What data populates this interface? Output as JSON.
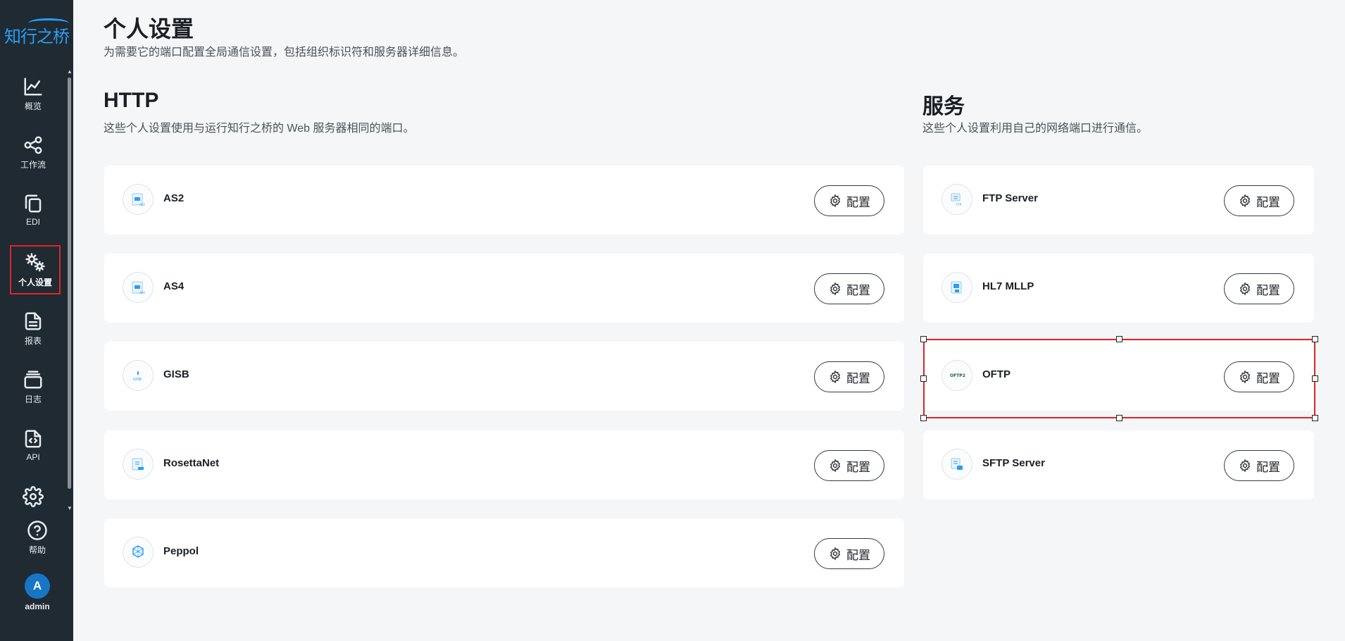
{
  "app": {
    "logo_text": "知行之桥"
  },
  "nav": {
    "items": [
      {
        "id": "overview",
        "label": "概览",
        "icon": "chart-line-icon"
      },
      {
        "id": "workflow",
        "label": "工作流",
        "icon": "share-nodes-icon"
      },
      {
        "id": "edi",
        "label": "EDI",
        "icon": "copy-docs-icon"
      },
      {
        "id": "profile",
        "label": "个人设置",
        "icon": "gears-icon",
        "active": true
      },
      {
        "id": "reports",
        "label": "报表",
        "icon": "document-icon"
      },
      {
        "id": "logs",
        "label": "日志",
        "icon": "layers-icon"
      },
      {
        "id": "api",
        "label": "API",
        "icon": "code-file-icon"
      },
      {
        "id": "settings",
        "label": "",
        "icon": "gear-icon"
      },
      {
        "id": "help",
        "label": "帮助",
        "icon": "help-icon"
      }
    ],
    "user": {
      "initial": "A",
      "name": "admin"
    }
  },
  "header": {
    "title": "个人设置",
    "subtitle": "为需要它的端口配置全局通信设置，包括组织标识符和服务器详细信息。"
  },
  "http": {
    "title": "HTTP",
    "subtitle": "这些个人设置使用与运行知行之桥的 Web 服务器相同的端口。",
    "cards": [
      {
        "label": "AS2",
        "icon": "as2-icon",
        "button": "配置"
      },
      {
        "label": "AS4",
        "icon": "as4-icon",
        "button": "配置"
      },
      {
        "label": "GISB",
        "icon": "gisb-icon",
        "button": "配置"
      },
      {
        "label": "RosettaNet",
        "icon": "rosettanet-icon",
        "button": "配置"
      },
      {
        "label": "Peppol",
        "icon": "peppol-icon",
        "button": "配置"
      }
    ]
  },
  "services": {
    "title": "服务",
    "subtitle": "这些个人设置利用自己的网络端口进行通信。",
    "cards": [
      {
        "label": "FTP Server",
        "icon": "ftp-server-icon",
        "button": "配置"
      },
      {
        "label": "HL7 MLLP",
        "icon": "hl7-icon",
        "button": "配置"
      },
      {
        "label": "OFTP",
        "icon": "oftp-icon",
        "button": "配置",
        "highlighted": true
      },
      {
        "label": "SFTP Server",
        "icon": "sftp-server-icon",
        "button": "配置"
      }
    ]
  },
  "colors": {
    "accent": "#1776c4",
    "highlight": "#e02424",
    "sidebar": "#1f2a33"
  }
}
